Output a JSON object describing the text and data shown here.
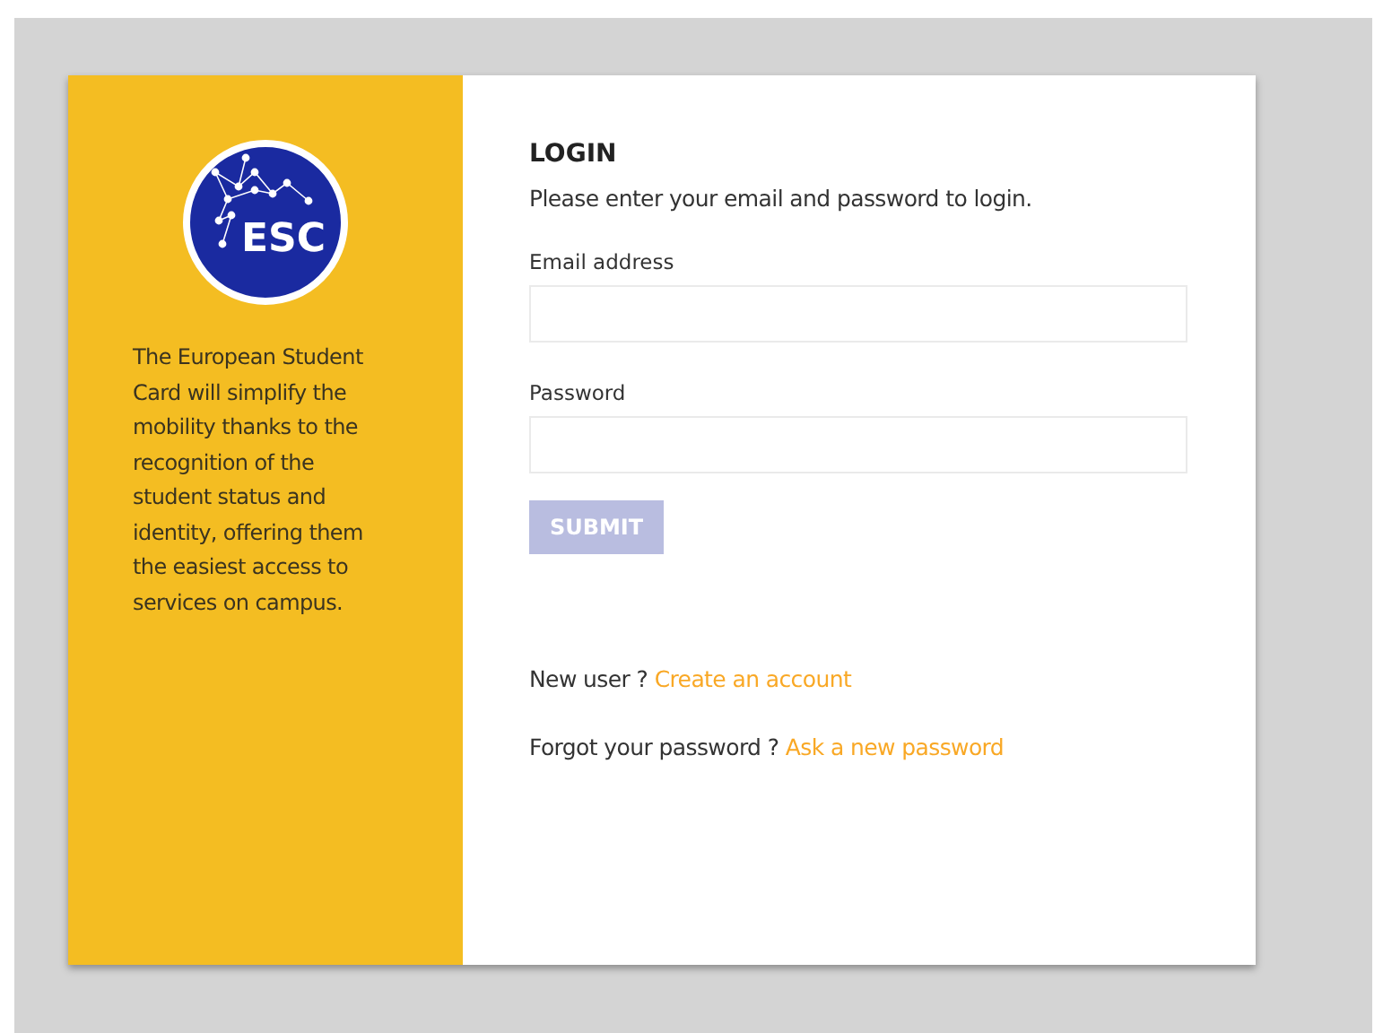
{
  "logo": {
    "text": "ESC"
  },
  "description": "The European Student Card will simplify the mobility thanks to the recognition of the student status and identity, offering them the easiest access to services on campus.",
  "login": {
    "title": "LOGIN",
    "subtitle": "Please enter your email and password to login.",
    "fields": [
      {
        "label": "Email address"
      },
      {
        "label": "Password"
      }
    ],
    "submit": {
      "label": "SUBMIT",
      "disabled": true
    }
  },
  "links": [
    {
      "prompt": "New user ?",
      "link": "Create an account"
    },
    {
      "prompt": "Forgot your password ?",
      "link": "Ask a new password"
    }
  ]
}
